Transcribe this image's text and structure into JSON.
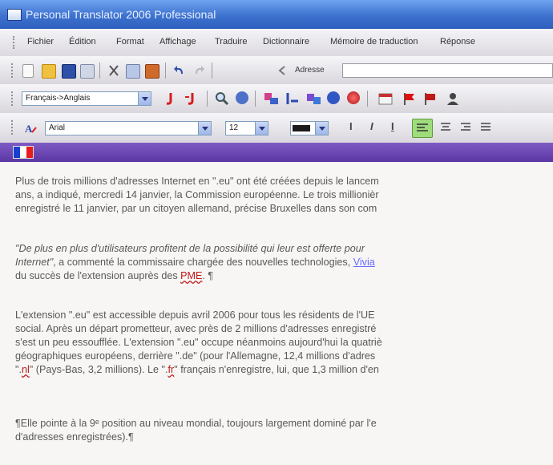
{
  "window": {
    "title": "Personal Translator 2006 Professional"
  },
  "menu": [
    "Fichier",
    "Édition",
    "Format",
    "Affichage",
    "Traduire",
    "Dictionnaire",
    "Mémoire de traduction",
    "Réponse"
  ],
  "toolbar1": {
    "address_label": "Adresse"
  },
  "toolbar2": {
    "direction": "Français->Anglais"
  },
  "toolbar3": {
    "font": "Arial",
    "size": "12"
  },
  "colors": {
    "title_bar": "#3d72cf",
    "lang_bar": "#5b36a4",
    "flag_blue": "#1a3fd0",
    "flag_red": "#e81c1c",
    "error": "#c01818",
    "link": "#6a6aff"
  },
  "document": {
    "p1": [
      "Plus de trois millions d'adresses Internet en \".eu\" ont été créées depuis le lancem",
      "ans, a indiqué, mercredi 14 janvier, la Commission européenne. Le trois millionièr",
      "enregistré le 11 janvier, par un citoyen allemand, précise Bruxelles dans son com"
    ],
    "p2_line1": "\"De plus en plus d'utilisateurs profitent de la possibilité qui leur est offerte pour",
    "p2_line2_a": "Internet\"",
    "p2_line2_b": ", a commenté la commissaire chargée des nouvelles technologies, ",
    "p2_line2_link": "Vivia",
    "p2_line3_a": "du succès de l'extension auprès des ",
    "p2_line3_err": "PME",
    "p2_line3_end": ". ¶",
    "p3": [
      "L'extension \".eu\" est accessible depuis avril 2006 pour tous les résidents de l'UE",
      "social. Après un départ prometteur, avec près de 2 millions d'adresses enregistré",
      "s'est un peu essoufflée. L'extension \".eu\" occupe néanmoins aujourd'hui la quatriè",
      "géographiques européens, derrière \".de\" (pour l'Allemagne, 12,4 millions d'adres"
    ],
    "p3_line5_a": "\".",
    "p3_line5_nl": "nl",
    "p3_line5_b": "\" (Pays-Bas, 3,2 millions). Le \".",
    "p3_line5_fr": "fr",
    "p3_line5_c": "\" français n'enregistre, lui, que 1,3 million d'en",
    "p4": [
      "¶Elle pointe à la 9ᵉ position au niveau mondial, toujours largement dominé par l'e",
      "d'adresses enregistrées).¶"
    ]
  }
}
